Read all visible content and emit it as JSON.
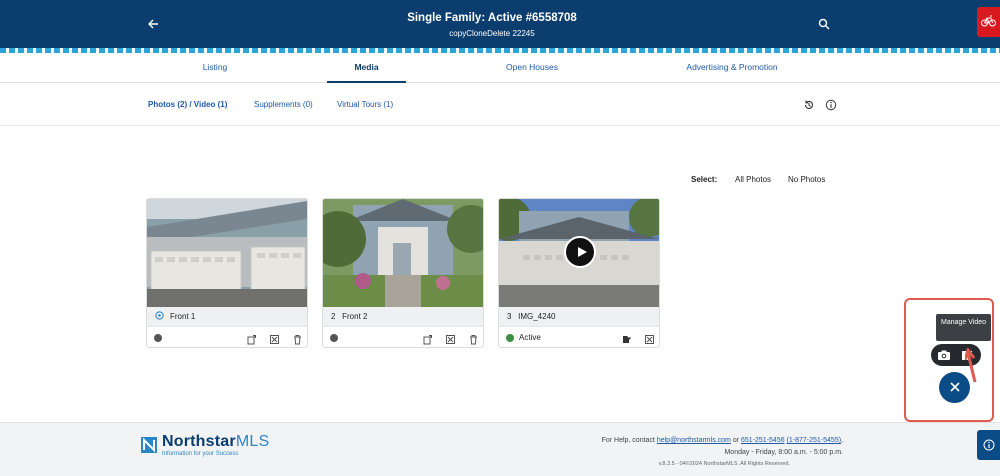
{
  "header": {
    "title": "Single Family: Active #6558708",
    "subtitle": "copyCloneDelete 22245",
    "back_icon": "arrow-left-icon",
    "search_icon": "search-icon",
    "bike_icon": "bicycle-icon"
  },
  "tabs": [
    {
      "label": "Listing",
      "active": false
    },
    {
      "label": "Media",
      "active": true
    },
    {
      "label": "Open Houses",
      "active": false
    },
    {
      "label": "Advertising & Promotion",
      "active": false
    }
  ],
  "subnav": {
    "links": [
      {
        "label": "Photos (2) / Video (1)",
        "active": true
      },
      {
        "label": "Supplements (0)",
        "active": false
      },
      {
        "label": "Virtual Tours (1)",
        "active": false
      }
    ]
  },
  "select": {
    "label": "Select:",
    "all": "All Photos",
    "none": "No Photos"
  },
  "cards": [
    {
      "caption_prefix": "",
      "caption": "Front 1",
      "status_text": "",
      "status_color": "#555555",
      "has_video_play": false
    },
    {
      "caption_prefix": "2",
      "caption": "Front 2",
      "status_text": "",
      "status_color": "#555555",
      "has_video_play": false
    },
    {
      "caption_prefix": "3",
      "caption": "IMG_4240",
      "status_text": "Active",
      "status_color": "#3e8e41",
      "has_video_play": true
    }
  ],
  "fab": {
    "tooltip": "Manage Video",
    "camera_icon": "camera-icon",
    "edit_icon": "edit-icon",
    "close_icon": "close-icon"
  },
  "footer": {
    "logo_main": "Northstar",
    "logo_mls": "MLS",
    "tagline": "Information for your Success",
    "help_prefix": "For Help, contact",
    "help_email": "help@northstarmls.com",
    "help_or": "or",
    "help_phone1": "651-251-5456",
    "help_phone2": "(1-877-251-5455)",
    "hours": "Monday - Friday, 8:00 a.m. - 5:00 p.m.",
    "version": "v.8.3.5 - 04©2024 NorthstarMLS. All Rights Reserved."
  },
  "colors": {
    "header": "#0b3d6e",
    "link": "#1e5aa8",
    "accent_red": "#d71920",
    "fab": "#0b4c86"
  }
}
